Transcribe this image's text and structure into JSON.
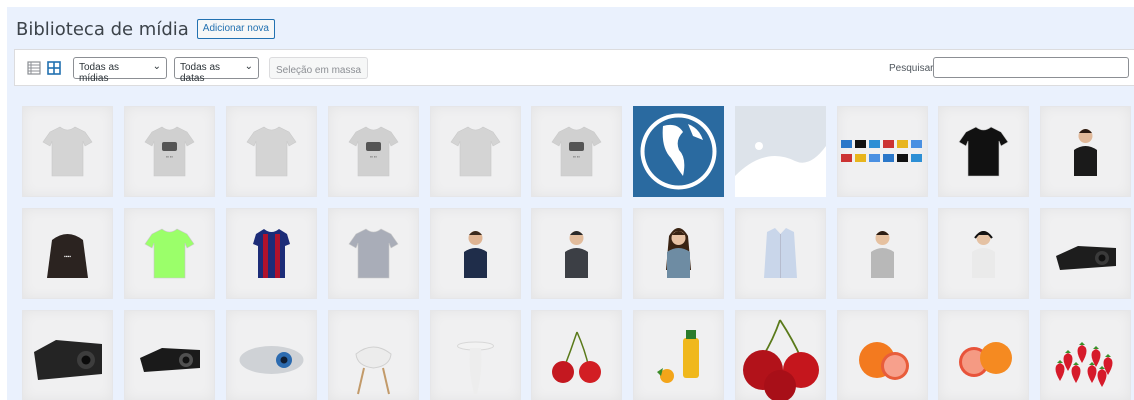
{
  "header": {
    "title": "Biblioteca de mídia",
    "add_new_label": "Adicionar nova"
  },
  "toolbar": {
    "list_view_icon": "list-icon",
    "grid_view_icon": "grid-icon",
    "type_filter": "Todas as mídias",
    "date_filter": "Todas as datas",
    "bulk_select_label": "Seleção em massa",
    "search_label": "Pesquisar",
    "search_value": ""
  },
  "colors": {
    "accent": "#2271b1",
    "page_bg": "#eaf1fd",
    "globe_bg": "#2a6aa0"
  },
  "media": [
    [
      "tshirt-gray",
      "tshirt-gray-print",
      "tshirt-gray",
      "tshirt-gray-print",
      "tshirt-gray",
      "tshirt-gray-print",
      "globe",
      "placeholder",
      "logos-strip",
      "tshirt-black",
      "woman-jacket"
    ],
    [
      "hoodie-black",
      "polo-green",
      "jersey-stripes",
      "tshirt-gray-plain",
      "man-navy-tee",
      "man-dark-tee",
      "woman-long-hair",
      "shirt-light-blue",
      "woman-arms-crossed",
      "man-headphones",
      "projector-black"
    ],
    [
      "projector-large",
      "projector-dark",
      "projector-silver",
      "chair-white",
      "table-white",
      "cherries",
      "juice-bottle",
      "cherries-large",
      "grapefruit",
      "grapefruit-halves",
      "strawberries"
    ]
  ]
}
